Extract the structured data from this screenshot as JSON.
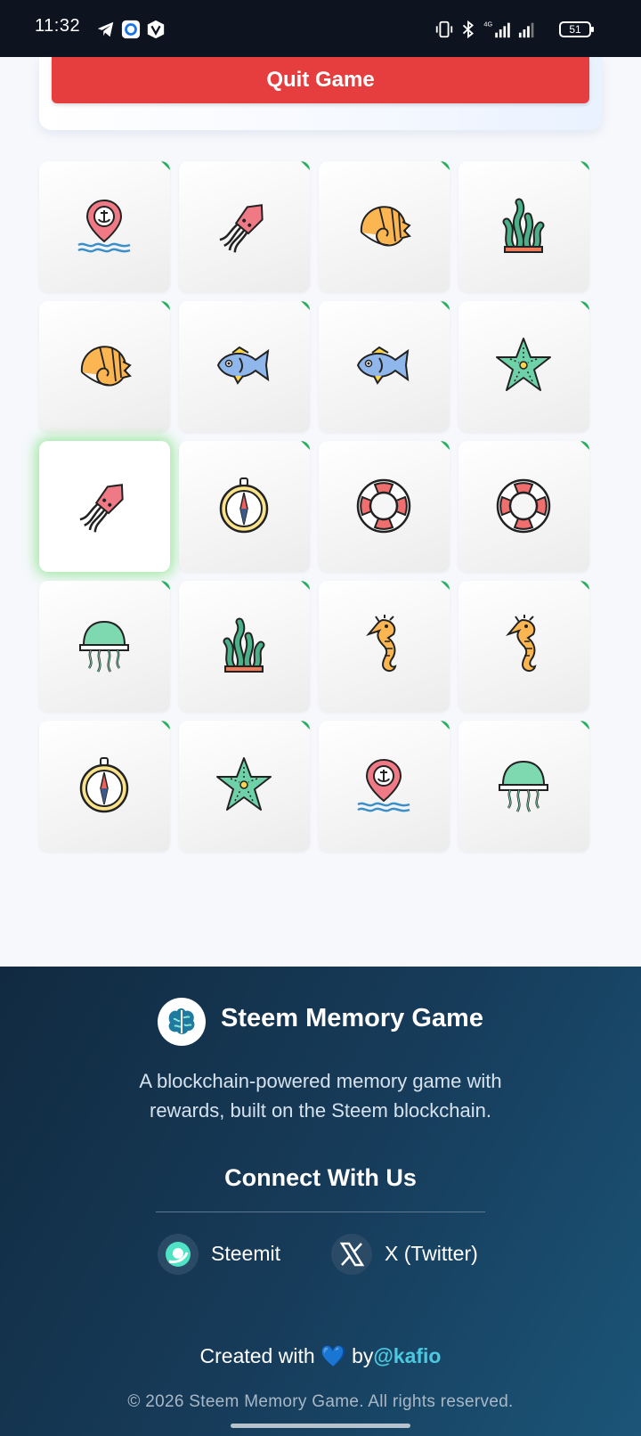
{
  "status_bar": {
    "time": "11:32",
    "battery": "51",
    "left_icons": [
      "telegram-icon",
      "app-icon",
      "vpn-icon"
    ],
    "right_icons": [
      "vibrate-icon",
      "bluetooth-icon",
      "signal-4g-icon",
      "signal-icon",
      "battery-icon"
    ]
  },
  "game": {
    "quit_label": "Quit Game",
    "cards": [
      {
        "icon": "anchor-pin-icon"
      },
      {
        "icon": "squid-icon"
      },
      {
        "icon": "nautilus-shell-icon"
      },
      {
        "icon": "seaweed-icon"
      },
      {
        "icon": "nautilus-shell-icon"
      },
      {
        "icon": "fish-icon"
      },
      {
        "icon": "fish-icon"
      },
      {
        "icon": "starfish-icon"
      },
      {
        "icon": "squid-icon",
        "selected": true
      },
      {
        "icon": "compass-icon"
      },
      {
        "icon": "lifebuoy-icon"
      },
      {
        "icon": "lifebuoy-icon"
      },
      {
        "icon": "jellyfish-icon"
      },
      {
        "icon": "seaweed-icon"
      },
      {
        "icon": "seahorse-icon"
      },
      {
        "icon": "seahorse-icon"
      },
      {
        "icon": "compass-icon"
      },
      {
        "icon": "starfish-icon"
      },
      {
        "icon": "anchor-pin-icon"
      },
      {
        "icon": "jellyfish-icon"
      }
    ]
  },
  "footer": {
    "brand_name": "Steem Memory Game",
    "tagline_line1": "A blockchain-powered memory game with",
    "tagline_line2": "rewards, built on the Steem blockchain.",
    "connect_title": "Connect With Us",
    "social": [
      {
        "label": "Steemit",
        "icon": "steemit-icon"
      },
      {
        "label": "X (Twitter)",
        "icon": "x-twitter-icon"
      }
    ],
    "credit_prefix": "Created with",
    "credit_heart": "💙",
    "credit_by": "by",
    "credit_handle": "@kafio",
    "copyright": "© 2026 Steem Memory Game. All rights reserved."
  },
  "colors": {
    "quit_button": "#e63e3e",
    "footer_gradient_start": "#112a40",
    "footer_gradient_end": "#1b5578",
    "handle": "#4cc8e0",
    "selected_glow": "#5adc5a",
    "matched_corner": "#27ae60"
  }
}
